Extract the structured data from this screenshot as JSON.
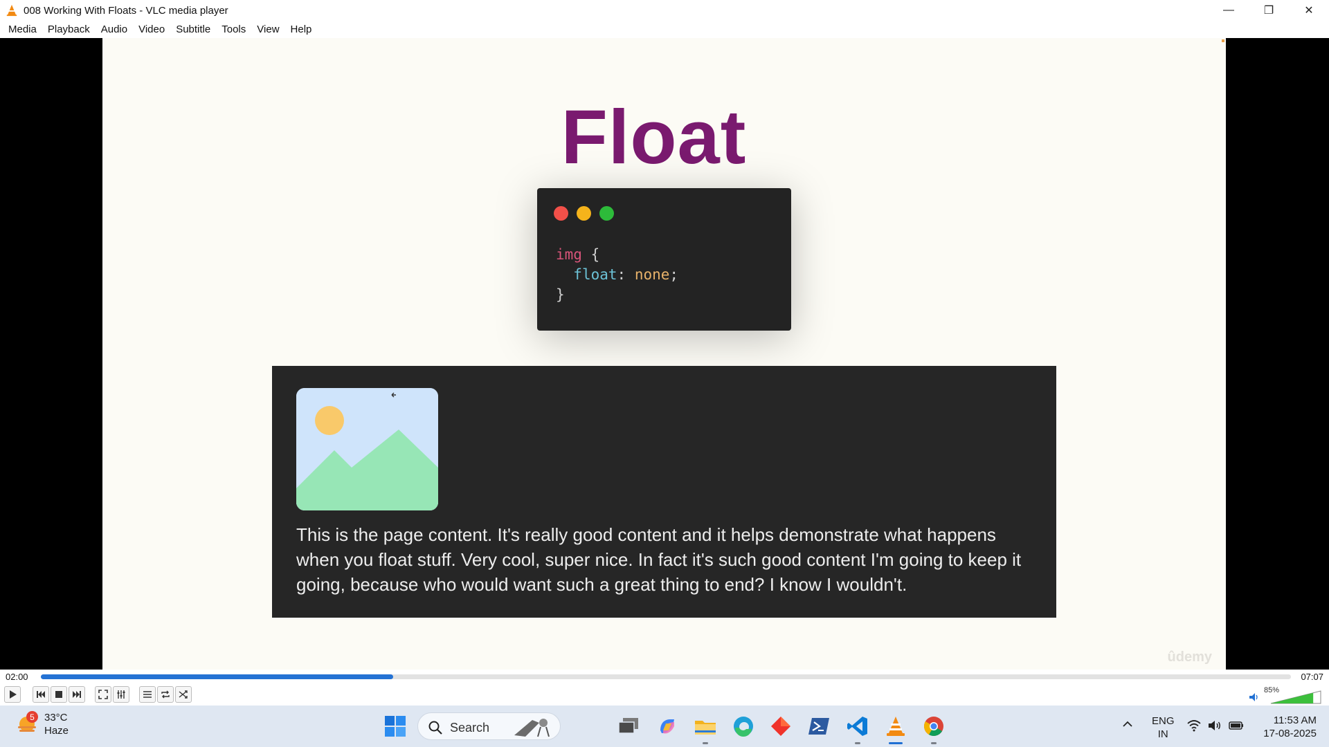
{
  "window": {
    "title": "008 Working With Floats - VLC media player",
    "controls": {
      "minimize": "—",
      "restore": "❐",
      "close": "✕"
    }
  },
  "menu": [
    "Media",
    "Playback",
    "Audio",
    "Video",
    "Subtitle",
    "Tools",
    "View",
    "Help"
  ],
  "slide": {
    "heading": "Float",
    "code_lines": [
      {
        "selector": "img",
        "open": " {"
      },
      {
        "property": "float",
        "colon": ": ",
        "value": "none",
        "semi": ";"
      },
      {
        "close": "}"
      }
    ],
    "demo_text": "This is the page content. It's really good content and it helps demonstrate what happens when you float stuff. Very cool, super nice. In fact it's such good content I'm going to keep it going, because who would want such a great thing to end? I know I wouldn't.",
    "watermark": "ûdemy",
    "dot_colors": [
      "#f25049",
      "#f5b31b",
      "#2dbb3a"
    ]
  },
  "player": {
    "elapsed": "02:00",
    "total": "07:07",
    "progress_fraction": 0.282,
    "volume_label": "85%",
    "volume_fraction": 0.85
  },
  "taskbar": {
    "weather_temp": "33°C",
    "weather_desc": "Haze",
    "weather_badge": "5",
    "search_label": "Search",
    "lang_top": "ENG",
    "lang_bottom": "IN",
    "time": "11:53 AM",
    "date": "17-08-2025"
  },
  "colors": {
    "heading": "#7a1a6f",
    "accent_blue": "#2472d4",
    "code_bg": "#232323"
  }
}
